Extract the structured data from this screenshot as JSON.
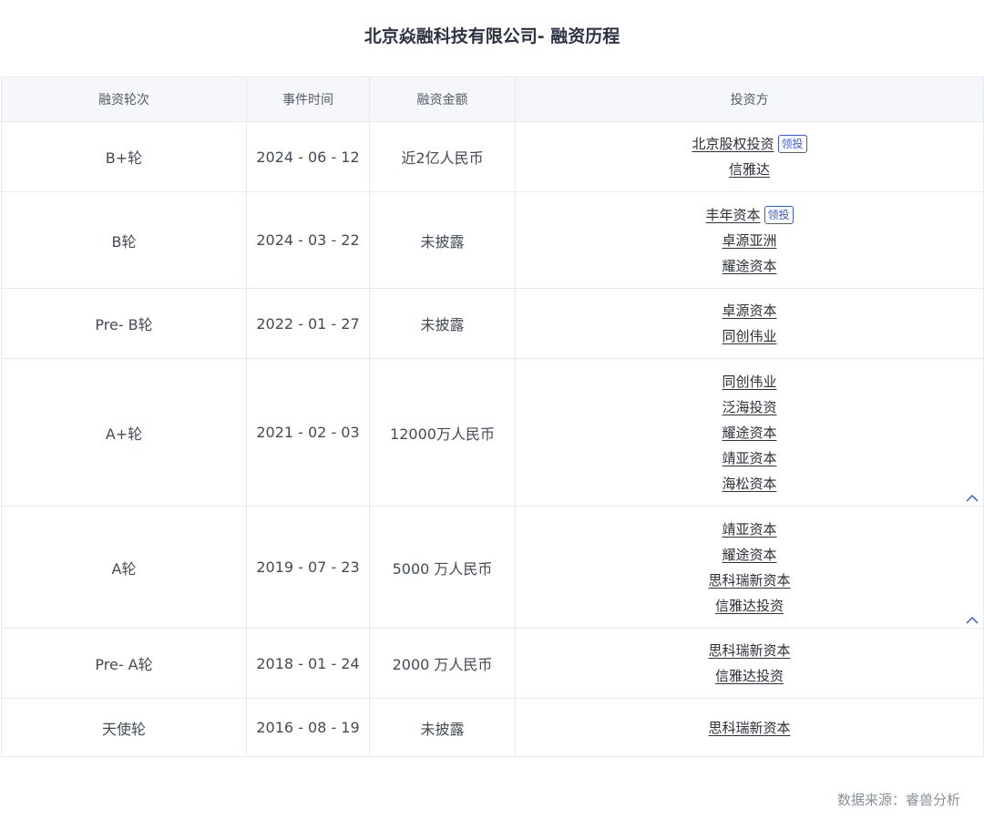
{
  "title": "北京焱融科技有限公司- 融资历程",
  "table": {
    "headers": [
      "融资轮次",
      "事件时间",
      "融资金额",
      "投资方"
    ],
    "rows": [
      {
        "round": "B+轮",
        "date": "2024 - 06 - 12",
        "amount": "近2亿人民币",
        "investors": [
          {
            "name": "北京股权投资",
            "lead": "领投"
          },
          {
            "name": "信雅达"
          }
        ],
        "collapsible": false
      },
      {
        "round": "B轮",
        "date": "2024 - 03 - 22",
        "amount": "未披露",
        "investors": [
          {
            "name": "丰年资本",
            "lead": "领投"
          },
          {
            "name": "卓源亚洲"
          },
          {
            "name": "耀途资本"
          }
        ],
        "collapsible": false
      },
      {
        "round": "Pre- B轮",
        "date": "2022 - 01 - 27",
        "amount": "未披露",
        "investors": [
          {
            "name": "卓源资本"
          },
          {
            "name": "同创伟业"
          }
        ],
        "collapsible": false
      },
      {
        "round": "A+轮",
        "date": "2021 - 02 - 03",
        "amount": "12000万人民币",
        "investors": [
          {
            "name": "同创伟业"
          },
          {
            "name": "泛海投资"
          },
          {
            "name": "耀途资本"
          },
          {
            "name": "靖亚资本"
          },
          {
            "name": "海松资本"
          }
        ],
        "collapsible": true
      },
      {
        "round": "A轮",
        "date": "2019 - 07 - 23",
        "amount": "5000 万人民币",
        "investors": [
          {
            "name": "靖亚资本"
          },
          {
            "name": "耀途资本"
          },
          {
            "name": "思科瑞新资本"
          },
          {
            "name": "信雅达投资"
          }
        ],
        "collapsible": true
      },
      {
        "round": "Pre- A轮",
        "date": "2018 - 01 - 24",
        "amount": "2000 万人民币",
        "investors": [
          {
            "name": "思科瑞新资本"
          },
          {
            "name": "信雅达投资"
          }
        ],
        "collapsible": false
      },
      {
        "round": "天使轮",
        "date": "2016 - 08 - 19",
        "amount": "未披露",
        "investors": [
          {
            "name": "思科瑞新资本"
          }
        ],
        "collapsible": false
      }
    ]
  },
  "source": "数据来源：睿兽分析",
  "colors": {
    "accent": "#3b5bdb",
    "header_bg": "#f5f7fa",
    "border": "#e6e9f0"
  },
  "icons": {
    "collapse": "chevron-up-icon"
  }
}
